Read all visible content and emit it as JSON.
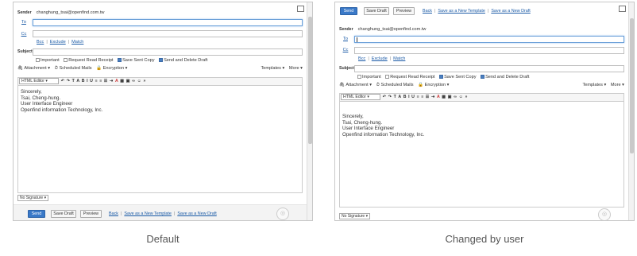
{
  "compose": {
    "sender_label": "Sender",
    "sender_email": "changhung_tsai@openfind.com.tw",
    "to_label": "To",
    "cc_label": "Cc",
    "bcc_link": "Bcc",
    "exclude_link": "Exclude",
    "match_link": "Match",
    "subject_label": "Subject",
    "options": {
      "important": "Important",
      "read_receipt": "Request Read Receipt",
      "save_sent": "Save Sent Copy",
      "send_delete_draft": "Send and Delete Draft"
    },
    "attachment": "Attachment",
    "scheduled": "Scheduled Mails",
    "encryption": "Encryption",
    "templates": "Templates",
    "more": "More",
    "editor_mode": "HTML Editor",
    "body_lines": [
      "Sincerely,",
      "Tsai, Cheng-hung.",
      "User Interface Engineer",
      "Openfind information Technology, Inc."
    ],
    "signature": "No Signature",
    "buttons": {
      "send": "Send",
      "save_draft": "Save Draft",
      "preview": "Preview",
      "back": "Back",
      "save_template": "Save as a New Template",
      "save_draft_new": "Save as a New Draft"
    }
  },
  "captions": {
    "left": "Default",
    "right": "Changed by user"
  },
  "colors": {
    "accent": "#3a79c8",
    "link": "#1a5aa6"
  }
}
